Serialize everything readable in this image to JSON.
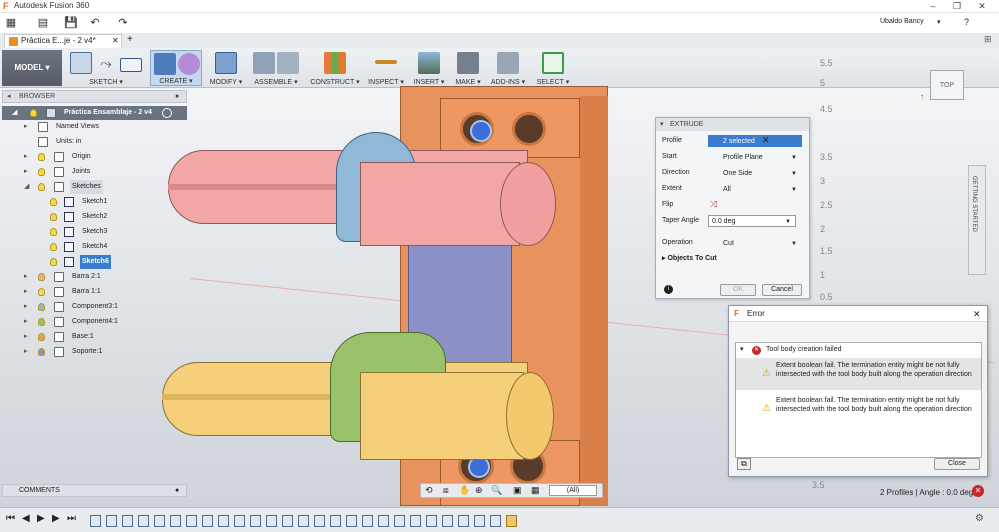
{
  "titlebar": {
    "app_title": "Autodesk Fusion 360",
    "user": "Ubaldo Bancy",
    "user_caret": "▾",
    "help": "?"
  },
  "doc_tab": {
    "title": "Práctica E...je - 2 v4*",
    "close": "✕",
    "add": "+"
  },
  "toolbar": {
    "model": "MODEL ▾",
    "groups": [
      "SKETCH ▾",
      "CREATE ▾",
      "MODIFY ▾",
      "ASSEMBLE ▾",
      "CONSTRUCT ▾",
      "INSPECT ▾",
      "INSERT ▾",
      "MAKE ▾",
      "ADD-INS ▾",
      "SELECT ▾"
    ]
  },
  "browser": {
    "header": "BROWSER",
    "root": "Práctica Ensamblaje - 2 v4",
    "items": [
      {
        "label": "Named Views"
      },
      {
        "label": "Units: in"
      },
      {
        "label": "Origin"
      },
      {
        "label": "Joints"
      },
      {
        "label": "Sketches"
      },
      {
        "label": "Sketch1"
      },
      {
        "label": "Sketch2"
      },
      {
        "label": "Sketch3"
      },
      {
        "label": "Sketch4"
      },
      {
        "label": "Sketch6"
      },
      {
        "label": "Barra 2:1"
      },
      {
        "label": "Barra 1:1"
      },
      {
        "label": "Component3:1"
      },
      {
        "label": "Component4:1"
      },
      {
        "label": "Base:1"
      },
      {
        "label": "Soporte:1"
      }
    ]
  },
  "extrude": {
    "title": "EXTRUDE",
    "rows": [
      {
        "label": "Profile",
        "value": "2 selected"
      },
      {
        "label": "Start",
        "value": "Profile Plane"
      },
      {
        "label": "Direction",
        "value": "One Side"
      },
      {
        "label": "Extent",
        "value": "All"
      },
      {
        "label": "Flip",
        "value": ""
      },
      {
        "label": "Taper Angle",
        "value": "0.0 deg"
      },
      {
        "label": "Operation",
        "value": "Cut"
      }
    ],
    "objects_to_cut": "Objects To Cut",
    "ok": "OK",
    "cancel": "Cancel"
  },
  "error": {
    "title": "Error",
    "summary": "Tool body creation failed",
    "messages": [
      "Extent boolean fail. The termination entity might be not fully intersected with the tool body built along the operation direction",
      "Extent boolean fail. The termination entity might be not fully intersected with the tool body built along the operation direction"
    ],
    "close": "Close"
  },
  "comments": "COMMENTS",
  "nav": {
    "zoom": "(All)"
  },
  "status": "2 Profiles | Angle : 0.0 deg",
  "viewcube": "TOP",
  "getting_started": "GETTING STARTED",
  "ruler": [
    "5.5",
    "5",
    "4.5",
    "3.5",
    "3",
    "2.5",
    "2",
    "1.5",
    "1",
    "0.5",
    "3.5"
  ],
  "colors": {
    "accent": "#3b7ccf",
    "orange": "#ef9a5e",
    "pink": "#f2a7a6",
    "yellow": "#f5cf7a",
    "blue_part": "#8fb9d6",
    "green_part": "#9ac26a",
    "purple": "#8c92c8"
  }
}
